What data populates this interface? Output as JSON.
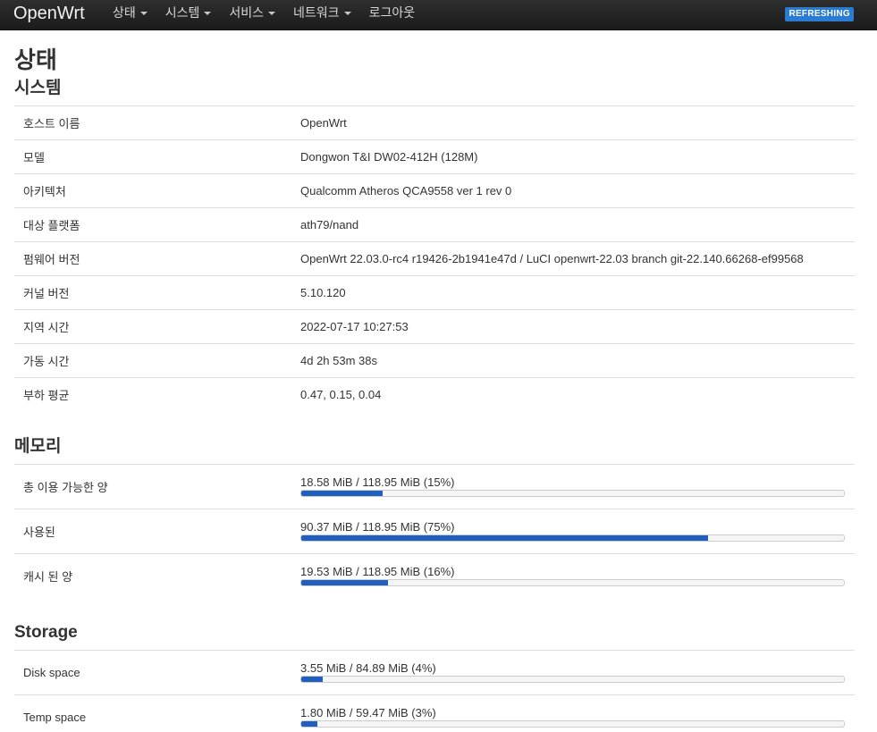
{
  "header": {
    "brand": "OpenWrt",
    "menu": [
      "상태",
      "시스템",
      "서비스",
      "네트워크",
      "로그아웃"
    ],
    "refresh_badge": "REFRESHING"
  },
  "page": {
    "title": "상태"
  },
  "system": {
    "title": "시스템",
    "rows": [
      {
        "label": "호스트 이름",
        "value": "OpenWrt"
      },
      {
        "label": "모델",
        "value": "Dongwon T&I DW02-412H (128M)"
      },
      {
        "label": "아키텍처",
        "value": "Qualcomm Atheros QCA9558 ver 1 rev 0"
      },
      {
        "label": "대상 플랫폼",
        "value": "ath79/nand"
      },
      {
        "label": "펌웨어 버전",
        "value": "OpenWrt 22.03.0-rc4 r19426-2b1941e47d / LuCI openwrt-22.03 branch git-22.140.66268-ef99568"
      },
      {
        "label": "커널 버전",
        "value": "5.10.120"
      },
      {
        "label": "지역 시간",
        "value": "2022-07-17 10:27:53"
      },
      {
        "label": "가동 시간",
        "value": "4d 2h 53m 38s"
      },
      {
        "label": "부하 평균",
        "value": "0.47, 0.15, 0.04"
      }
    ]
  },
  "memory": {
    "title": "메모리",
    "rows": [
      {
        "label": "총 이용 가능한 양",
        "value": "18.58 MiB / 118.95 MiB (15%)",
        "percent": 15
      },
      {
        "label": "사용된",
        "value": "90.37 MiB / 118.95 MiB (75%)",
        "percent": 75
      },
      {
        "label": "캐시 된 양",
        "value": "19.53 MiB / 118.95 MiB (16%)",
        "percent": 16
      }
    ]
  },
  "storage": {
    "title": "Storage",
    "rows": [
      {
        "label": "Disk space",
        "value": "3.55 MiB / 84.89 MiB (4%)",
        "percent": 4
      },
      {
        "label": "Temp space",
        "value": "1.80 MiB / 59.47 MiB (3%)",
        "percent": 3
      }
    ]
  },
  "colors": {
    "navbar": "#222222",
    "accent": "#1f5fbf",
    "badge": "#2a7cd2"
  }
}
